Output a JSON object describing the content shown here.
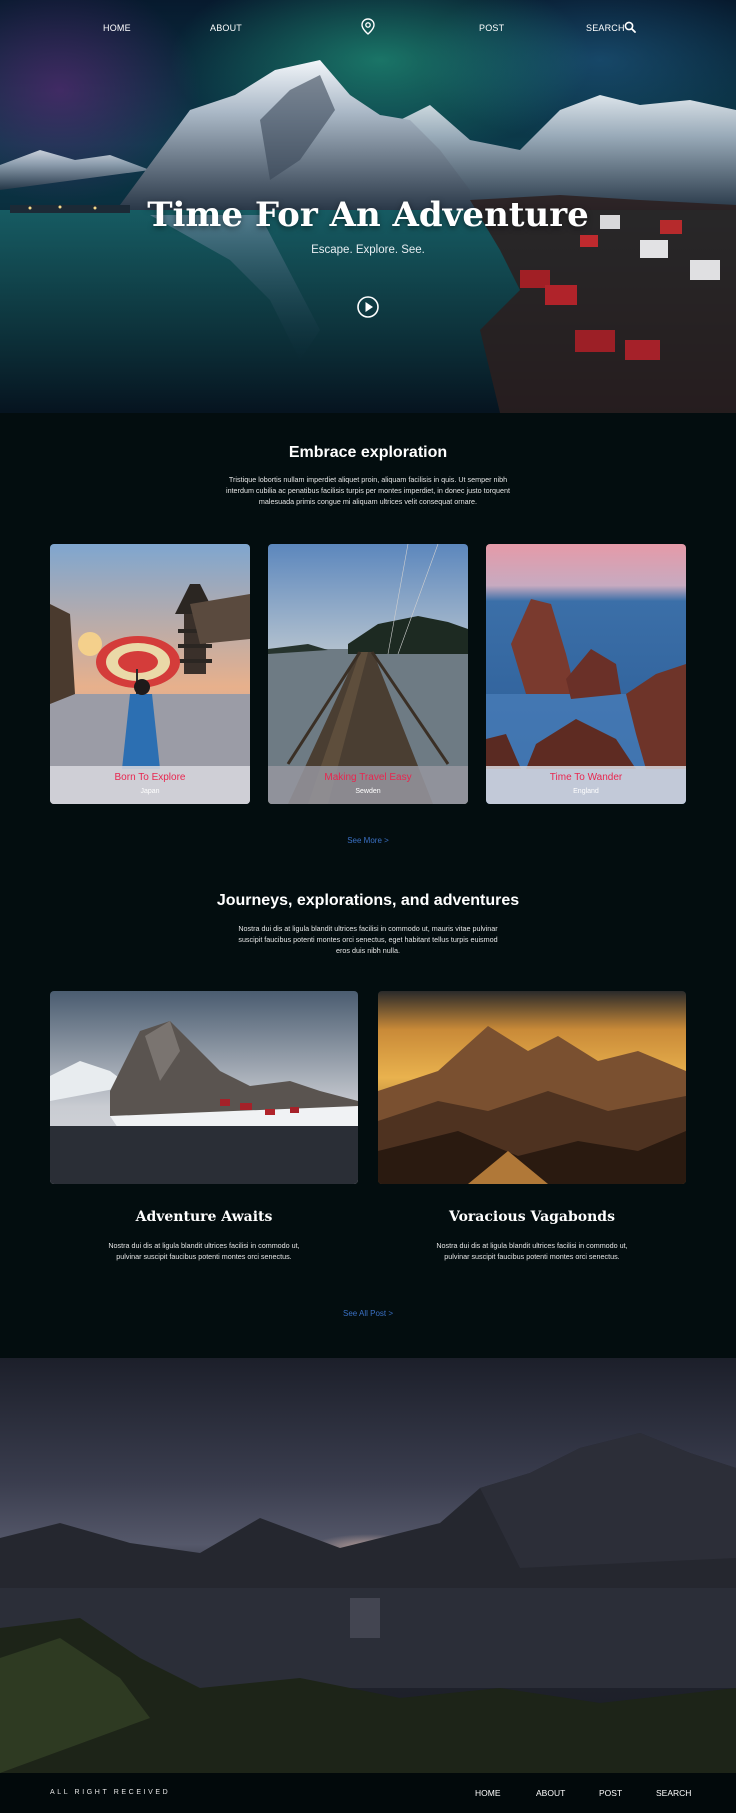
{
  "nav": {
    "home": "HOME",
    "about": "ABOUT",
    "post": "POST",
    "search": "SEARCH"
  },
  "hero": {
    "title": "Time For An Adventure",
    "subtitle": "Escape. Explore. See."
  },
  "explore": {
    "title": "Embrace exploration",
    "text_lines": [
      "Tristique lobortis nullam imperdiet aliquet proin, aliquam facilisis in quis. Ut semper nibh",
      "interdum cubilia ac penatibus facilisis turpis per montes imperdiet, in donec justo  torquent",
      "malesuada primis congue mi aliquam ultrices velit consequat ornare."
    ],
    "cards": [
      {
        "title": "Born To Explore",
        "subtitle": "Japan"
      },
      {
        "title": "Making Travel Easy",
        "subtitle": "Sewden"
      },
      {
        "title": "Time To Wander",
        "subtitle": "England"
      }
    ],
    "see_more": "See More  >"
  },
  "journeys": {
    "title": "Journeys, explorations, and adventures",
    "text_lines": [
      "Nostra dui dis at ligula blandit ultrices facilisi in commodo ut, mauris vitae pulvinar",
      "suscipit faucibus potenti montes orci senectus, eget habitant tellus turpis euismod",
      "eros duis nibh nulla."
    ],
    "posts": [
      {
        "title": "Adventure Awaits",
        "text_lines": [
          "Nostra dui dis at ligula blandit ultrices facilisi in commodo ut,",
          "pulvinar suscipit faucibus potenti montes orci senectus."
        ]
      },
      {
        "title": "Voracious Vagabonds",
        "text_lines": [
          "Nostra dui dis at ligula blandit ultrices facilisi in commodo ut,",
          "pulvinar suscipit faucibus potenti montes orci senectus."
        ]
      }
    ],
    "see_all": "See All Post  >"
  },
  "footer": {
    "copyright": "ALL RIGHT RECEIVED",
    "links": [
      "HOME",
      "ABOUT",
      "POST",
      "SEARCH"
    ]
  },
  "icons": {
    "nav_center": "location-pin-icon",
    "search": "search-icon",
    "play": "play-icon"
  },
  "colors": {
    "background": "#030d0f",
    "card_title": "#e8264f",
    "link_blue": "#3a70c4"
  }
}
